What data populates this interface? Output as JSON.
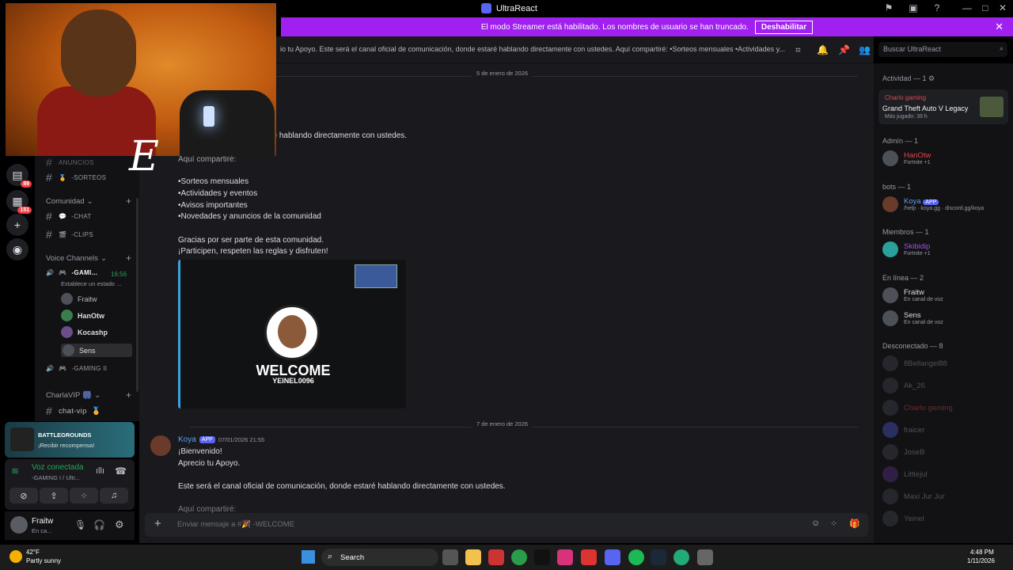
{
  "window": {
    "title": "UltraReact"
  },
  "banner": {
    "text": "El modo Streamer está habilitado. Los nombres de usuario se han truncado.",
    "button": "Deshabilitar"
  },
  "header": {
    "topic": "io tu Apoyo. Este será el canal oficial de comunicación, donde estaré hablando directamente con ustedes. Aquí compartiré: •Sorteos mensuales •Actividades y...",
    "search_placeholder": "Buscar UltraReact"
  },
  "rail": {
    "badges": [
      "89",
      "151"
    ]
  },
  "sidebar": {
    "truncated_top": "ANUNCIOS",
    "sorteos": "-SORTEOS",
    "cat_comunidad": "Comunidad",
    "chat": "-CHAT",
    "clips": "-CLIPS",
    "cat_voice": "Voice Channels",
    "voice1": "-GAMI...",
    "voice1_time": "16:56",
    "voice1_status": "Establece un estado ...",
    "voice_users": [
      "Fraitw",
      "HanOtw",
      "Kocashp",
      "Sens"
    ],
    "voice2": "-GAMING II",
    "cat_vip": "CharlaVIP",
    "vip_chan": "chat-vip"
  },
  "promo": {
    "game": "BATTLEGROUNDS",
    "cta": "¡Recibir recompensa!"
  },
  "voice": {
    "status": "Voz conectada",
    "channel": "-GAMING I / Ultr..."
  },
  "user": {
    "name": "Fraitw",
    "sub": "En ca..."
  },
  "chat": {
    "date1": "5 de enero de 2026",
    "line_top": "comunicación, donde estaré hablando directamente con ustedes.",
    "line_cut": "Aquí compartiré:",
    "bullets": [
      "•Sorteos mensuales",
      "•Actividades y eventos",
      "•Avisos importantes",
      "•Novedades y anuncios de la comunidad"
    ],
    "thanks1": "Gracias por ser parte de esta comunidad.",
    "thanks2": "¡Participen, respeten las reglas y disfruten!",
    "embed_title": "WELCOME",
    "embed_user": "YEINEL0096",
    "date2": "7 de enero de 2026",
    "author": "Koya",
    "app_tag": "APP",
    "timestamp": "07/01/2026 21:55",
    "m1": "¡Bienvenido!",
    "m2": "Aprecio tu Apoyo.",
    "m3": "Este será el canal oficial de comunicación, donde estaré hablando directamente con ustedes.",
    "m4": "Aquí compartiré:",
    "composer_placeholder": "Enviar mensaje a #🎉 -WELCOME"
  },
  "members": {
    "activity_header": "Actividad — 1",
    "activity_user": "Charlo gaming",
    "activity_game": "Grand Theft Auto V Legacy",
    "activity_played": "Más jugado: 39 h",
    "admin_header": "Admín — 1",
    "admin_name": "HanOtw",
    "admin_sub": "Fortnite +1",
    "bots_header": "bots — 1",
    "bot_name": "Koya",
    "bot_tag": "APP",
    "bot_sub": "/help · koya.gg · discord.gg/koya",
    "miembros_header": "Miembros — 1",
    "miembro_name": "Skibidip",
    "miembro_sub": "Fortnite +1",
    "online_header": "En línea — 2",
    "online": [
      {
        "name": "Fraitw",
        "sub": "En canal de voz"
      },
      {
        "name": "Sens",
        "sub": "En canal de voz"
      }
    ],
    "offline_header": "Desconectado — 8",
    "offline": [
      "8Bellangel88",
      "Ak_26",
      "Charlo gaming",
      "fraicer",
      "JoseB",
      "Littlejul",
      "Maxi Jur Jur",
      "Yeinel"
    ]
  },
  "taskbar": {
    "weather_temp": "42°F",
    "weather_desc": "Partly sunny",
    "search": "Search",
    "time": "4:48 PM",
    "date": "1/11/2026"
  },
  "colors": {
    "streamer": "#a020f0",
    "blurple": "#5865f2",
    "online": "#23a55a"
  }
}
